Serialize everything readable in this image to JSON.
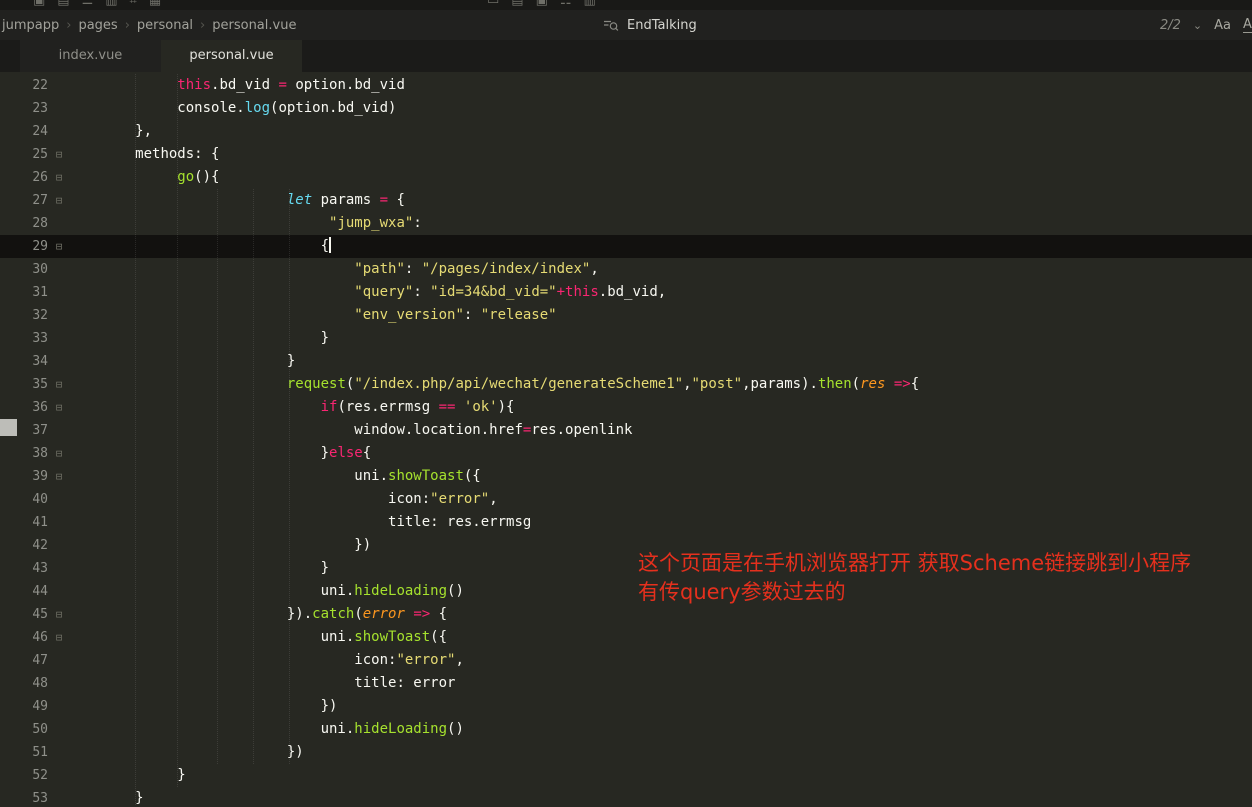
{
  "toolbar": {
    "left_icons": [
      {
        "name": "toolbar-icon",
        "glyph": "▣"
      },
      {
        "name": "toolbar-icon",
        "glyph": "▤"
      },
      {
        "name": "toolbar-icon",
        "glyph": "☰"
      },
      {
        "name": "toolbar-icon",
        "glyph": "▥"
      },
      {
        "name": "toolbar-icon",
        "glyph": "⌗"
      },
      {
        "name": "toolbar-icon",
        "glyph": "▦"
      }
    ],
    "center_icons": [
      {
        "name": "toolbar-icon",
        "glyph": "▭"
      },
      {
        "name": "toolbar-icon",
        "glyph": "▤"
      },
      {
        "name": "toolbar-icon",
        "glyph": "▣"
      },
      {
        "name": "toolbar-icon",
        "glyph": "☷"
      },
      {
        "name": "toolbar-icon",
        "glyph": "▥"
      }
    ]
  },
  "breadcrumb": {
    "items": [
      "jumpapp",
      "pages",
      "personal",
      "personal.vue"
    ],
    "separator": "›"
  },
  "search": {
    "icon": "search-filter-icon",
    "query": "EndTalking",
    "result_count": "2/2",
    "dropdown_caret": "⌄",
    "match_case_label": "Aa",
    "whole_word_label": "Ab"
  },
  "tabs": [
    {
      "label": "index.vue",
      "active": false
    },
    {
      "label": "personal.vue",
      "active": true
    }
  ],
  "annotation": {
    "line1": "这个页面是在手机浏览器打开 获取Scheme链接跳到小程序",
    "line2": "有传query参数过去的"
  },
  "editor": {
    "language": "vue/javascript",
    "current_line": 29,
    "first_visible_line": 22,
    "lines": [
      {
        "num": 22,
        "indent": 10,
        "fold": false,
        "segs": [
          [
            "kw",
            "this"
          ],
          [
            "pl",
            ".bd_vid "
          ],
          [
            "kw",
            "="
          ],
          [
            "pl",
            " option.bd_vid"
          ]
        ]
      },
      {
        "num": 23,
        "indent": 10,
        "fold": false,
        "segs": [
          [
            "pl",
            "console."
          ],
          [
            "sup",
            "log"
          ],
          [
            "pl",
            "(option.bd_vid)"
          ]
        ]
      },
      {
        "num": 24,
        "indent": 5,
        "fold": false,
        "segs": [
          [
            "pl",
            "},"
          ]
        ]
      },
      {
        "num": 25,
        "indent": 5,
        "fold": true,
        "segs": [
          [
            "pl",
            "methods: {"
          ]
        ]
      },
      {
        "num": 26,
        "indent": 10,
        "fold": true,
        "segs": [
          [
            "fn",
            "go"
          ],
          [
            "pl",
            "(){"
          ]
        ]
      },
      {
        "num": 27,
        "indent": 23,
        "fold": true,
        "segs": [
          [
            "supi",
            "let"
          ],
          [
            "pl",
            " params "
          ],
          [
            "kw",
            "="
          ],
          [
            "pl",
            " {"
          ]
        ]
      },
      {
        "num": 28,
        "indent": 28,
        "fold": false,
        "segs": [
          [
            "str",
            "\"jump_wxa\""
          ],
          [
            "pl",
            ":"
          ]
        ]
      },
      {
        "num": 29,
        "indent": 27,
        "fold": true,
        "cursor": true,
        "segs": [
          [
            "pl",
            "{"
          ]
        ]
      },
      {
        "num": 30,
        "indent": 31,
        "fold": false,
        "segs": [
          [
            "str",
            "\"path\""
          ],
          [
            "pl",
            ": "
          ],
          [
            "str",
            "\"/pages/index/index\""
          ],
          [
            "pl",
            ","
          ]
        ]
      },
      {
        "num": 31,
        "indent": 31,
        "fold": false,
        "segs": [
          [
            "str",
            "\"query\""
          ],
          [
            "pl",
            ": "
          ],
          [
            "str",
            "\"id=34&bd_vid=\""
          ],
          [
            "kw",
            "+this"
          ],
          [
            "pl",
            ".bd_vid,"
          ]
        ]
      },
      {
        "num": 32,
        "indent": 31,
        "fold": false,
        "segs": [
          [
            "str",
            "\"env_version\""
          ],
          [
            "pl",
            ": "
          ],
          [
            "str",
            "\"release\""
          ]
        ]
      },
      {
        "num": 33,
        "indent": 27,
        "fold": false,
        "segs": [
          [
            "pl",
            "}"
          ]
        ]
      },
      {
        "num": 34,
        "indent": 23,
        "fold": false,
        "segs": [
          [
            "pl",
            "}"
          ]
        ]
      },
      {
        "num": 35,
        "indent": 23,
        "fold": true,
        "segs": [
          [
            "fn",
            "request"
          ],
          [
            "pl",
            "("
          ],
          [
            "str",
            "\"/index.php/api/wechat/generateScheme1\""
          ],
          [
            "pl",
            ","
          ],
          [
            "str",
            "\"post\""
          ],
          [
            "pl",
            ",params)."
          ],
          [
            "fn",
            "then"
          ],
          [
            "pl",
            "("
          ],
          [
            "arg",
            "res"
          ],
          [
            "pl",
            " "
          ],
          [
            "kw",
            "=>"
          ],
          [
            "pl",
            "{"
          ]
        ]
      },
      {
        "num": 36,
        "indent": 27,
        "fold": true,
        "segs": [
          [
            "kw",
            "if"
          ],
          [
            "pl",
            "(res.errmsg "
          ],
          [
            "kw",
            "=="
          ],
          [
            "pl",
            " "
          ],
          [
            "str",
            "'ok'"
          ],
          [
            "pl",
            "){"
          ]
        ]
      },
      {
        "num": 37,
        "indent": 31,
        "fold": false,
        "segs": [
          [
            "pl",
            "window.location.href"
          ],
          [
            "kw",
            "="
          ],
          [
            "pl",
            "res.openlink"
          ]
        ]
      },
      {
        "num": 38,
        "indent": 27,
        "fold": true,
        "segs": [
          [
            "pl",
            "}"
          ],
          [
            "kw",
            "else"
          ],
          [
            "pl",
            "{"
          ]
        ]
      },
      {
        "num": 39,
        "indent": 31,
        "fold": true,
        "segs": [
          [
            "pl",
            "uni."
          ],
          [
            "fn",
            "showToast"
          ],
          [
            "pl",
            "({"
          ]
        ]
      },
      {
        "num": 40,
        "indent": 35,
        "fold": false,
        "segs": [
          [
            "pl",
            "icon:"
          ],
          [
            "str",
            "\"error\""
          ],
          [
            "pl",
            ","
          ]
        ]
      },
      {
        "num": 41,
        "indent": 35,
        "fold": false,
        "segs": [
          [
            "pl",
            "title: res.errmsg"
          ]
        ]
      },
      {
        "num": 42,
        "indent": 31,
        "fold": false,
        "segs": [
          [
            "pl",
            "})"
          ]
        ]
      },
      {
        "num": 43,
        "indent": 27,
        "fold": false,
        "segs": [
          [
            "pl",
            "}"
          ]
        ]
      },
      {
        "num": 44,
        "indent": 27,
        "fold": false,
        "segs": [
          [
            "pl",
            "uni."
          ],
          [
            "fn",
            "hideLoading"
          ],
          [
            "pl",
            "()"
          ]
        ]
      },
      {
        "num": 45,
        "indent": 23,
        "fold": true,
        "segs": [
          [
            "pl",
            "})."
          ],
          [
            "fn",
            "catch"
          ],
          [
            "pl",
            "("
          ],
          [
            "arg",
            "error"
          ],
          [
            "pl",
            " "
          ],
          [
            "kw",
            "=>"
          ],
          [
            "pl",
            " {"
          ]
        ]
      },
      {
        "num": 46,
        "indent": 27,
        "fold": true,
        "segs": [
          [
            "pl",
            "uni."
          ],
          [
            "fn",
            "showToast"
          ],
          [
            "pl",
            "({"
          ]
        ]
      },
      {
        "num": 47,
        "indent": 31,
        "fold": false,
        "segs": [
          [
            "pl",
            "icon:"
          ],
          [
            "str",
            "\"error\""
          ],
          [
            "pl",
            ","
          ]
        ]
      },
      {
        "num": 48,
        "indent": 31,
        "fold": false,
        "segs": [
          [
            "pl",
            "title: error"
          ]
        ]
      },
      {
        "num": 49,
        "indent": 27,
        "fold": false,
        "segs": [
          [
            "pl",
            "})"
          ]
        ]
      },
      {
        "num": 50,
        "indent": 27,
        "fold": false,
        "segs": [
          [
            "pl",
            "uni."
          ],
          [
            "fn",
            "hideLoading"
          ],
          [
            "pl",
            "()"
          ]
        ]
      },
      {
        "num": 51,
        "indent": 23,
        "fold": false,
        "segs": [
          [
            "pl",
            "})"
          ]
        ]
      },
      {
        "num": 52,
        "indent": 10,
        "fold": false,
        "segs": [
          [
            "pl",
            "}"
          ]
        ]
      },
      {
        "num": 53,
        "indent": 5,
        "fold": false,
        "segs": [
          [
            "pl",
            "}"
          ]
        ]
      }
    ]
  },
  "colors": {
    "editor_bg": "#272822",
    "current_line_bg": "#12110f",
    "keyword": "#f92672",
    "string": "#e6db74",
    "function": "#a6e22e",
    "support": "#66d9ef",
    "parameter": "#fd971f",
    "text": "#f8f8f2",
    "line_number": "#8f908a",
    "annotation_red": "#e5301d"
  }
}
